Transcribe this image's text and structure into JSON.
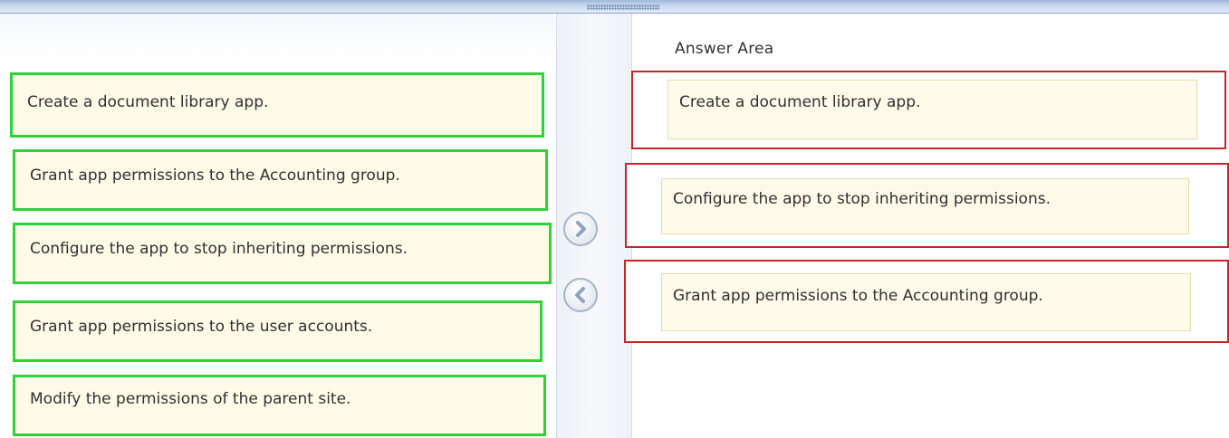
{
  "answer_area": {
    "title": "Answer Area",
    "items": [
      {
        "label": "Create a document library app."
      },
      {
        "label": "Configure the app to stop inheriting permissions."
      },
      {
        "label": "Grant app permissions to the Accounting group."
      }
    ]
  },
  "source_items": [
    {
      "label": "Create a document library app."
    },
    {
      "label": "Grant app permissions to the Accounting group."
    },
    {
      "label": "Configure the app to stop inheriting permissions."
    },
    {
      "label": "Grant app permissions to the user accounts."
    },
    {
      "label": "Modify the permissions of the parent site."
    }
  ],
  "controls": {
    "move_right_icon": "chevron-right-icon",
    "move_left_icon": "chevron-left-icon"
  },
  "colors": {
    "source_border": "#2fd23a",
    "answer_slot_border": "#c9242a",
    "item_background": "#fffbe9"
  }
}
